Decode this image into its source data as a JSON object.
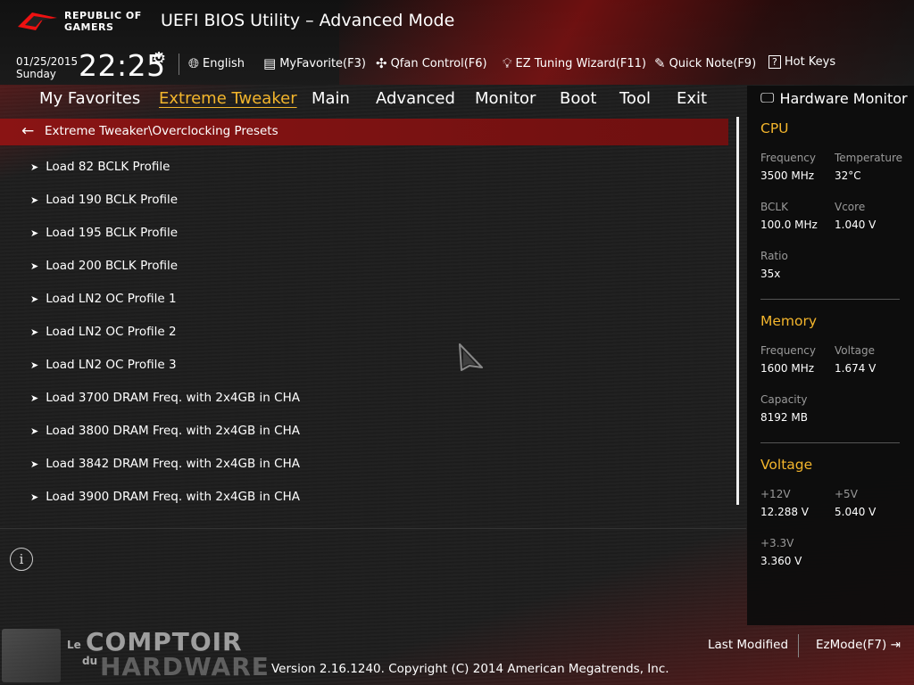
{
  "brand": {
    "line1": "REPUBLIC OF",
    "line2": "GAMERS"
  },
  "app_title": "UEFI BIOS Utility – Advanced Mode",
  "datetime": {
    "date": "01/25/2015",
    "day": "Sunday",
    "time": "22:25"
  },
  "toolbar": {
    "language": "English",
    "myfavorite": "MyFavorite(F3)",
    "qfan": "Qfan Control(F6)",
    "ez_tuning": "EZ Tuning Wizard(F11)",
    "quick_note": "Quick Note(F9)",
    "hot_keys": "Hot Keys"
  },
  "nav": {
    "tabs": [
      "My Favorites",
      "Extreme Tweaker",
      "Main",
      "Advanced",
      "Monitor",
      "Boot",
      "Tool",
      "Exit"
    ],
    "active": "Extreme Tweaker"
  },
  "breadcrumb": "Extreme Tweaker\\Overclocking Presets",
  "presets": [
    "Load 82 BCLK Profile",
    "Load 190 BCLK Profile",
    "Load 195 BCLK Profile",
    "Load 200 BCLK Profile",
    "Load LN2 OC Profile 1",
    "Load LN2 OC Profile 2",
    "Load LN2 OC Profile 3",
    "Load 3700 DRAM Freq. with 2x4GB in CHA",
    "Load 3800 DRAM Freq. with 2x4GB in CHA",
    "Load 3842 DRAM Freq. with 2x4GB in CHA",
    "Load 3900 DRAM Freq. with 2x4GB in CHA"
  ],
  "hw_monitor": {
    "title": "Hardware Monitor",
    "cpu": {
      "heading": "CPU",
      "freq_label": "Frequency",
      "freq_value": "3500 MHz",
      "temp_label": "Temperature",
      "temp_value": "32°C",
      "bclk_label": "BCLK",
      "bclk_value": "100.0 MHz",
      "vcore_label": "Vcore",
      "vcore_value": "1.040 V",
      "ratio_label": "Ratio",
      "ratio_value": "35x"
    },
    "memory": {
      "heading": "Memory",
      "freq_label": "Frequency",
      "freq_value": "1600 MHz",
      "volt_label": "Voltage",
      "volt_value": "1.674 V",
      "cap_label": "Capacity",
      "cap_value": "8192 MB"
    },
    "voltage": {
      "heading": "Voltage",
      "v12_label": "+12V",
      "v12_value": "12.288 V",
      "v5_label": "+5V",
      "v5_value": "5.040 V",
      "v33_label": "+3.3V",
      "v33_value": "3.360 V"
    }
  },
  "footer": {
    "last_modified": "Last Modified",
    "ez_mode": "EzMode(F7)",
    "version": "Version 2.16.1240. Copyright (C) 2014 American Megatrends, Inc."
  },
  "watermark": {
    "le": "Le",
    "du": "du",
    "word1": "COMPTOIR",
    "word2": "HARDWARE"
  },
  "colors": {
    "accent": "#f3b52c",
    "crumb_bar": "#8a1414",
    "brand_red": "#c81414"
  }
}
